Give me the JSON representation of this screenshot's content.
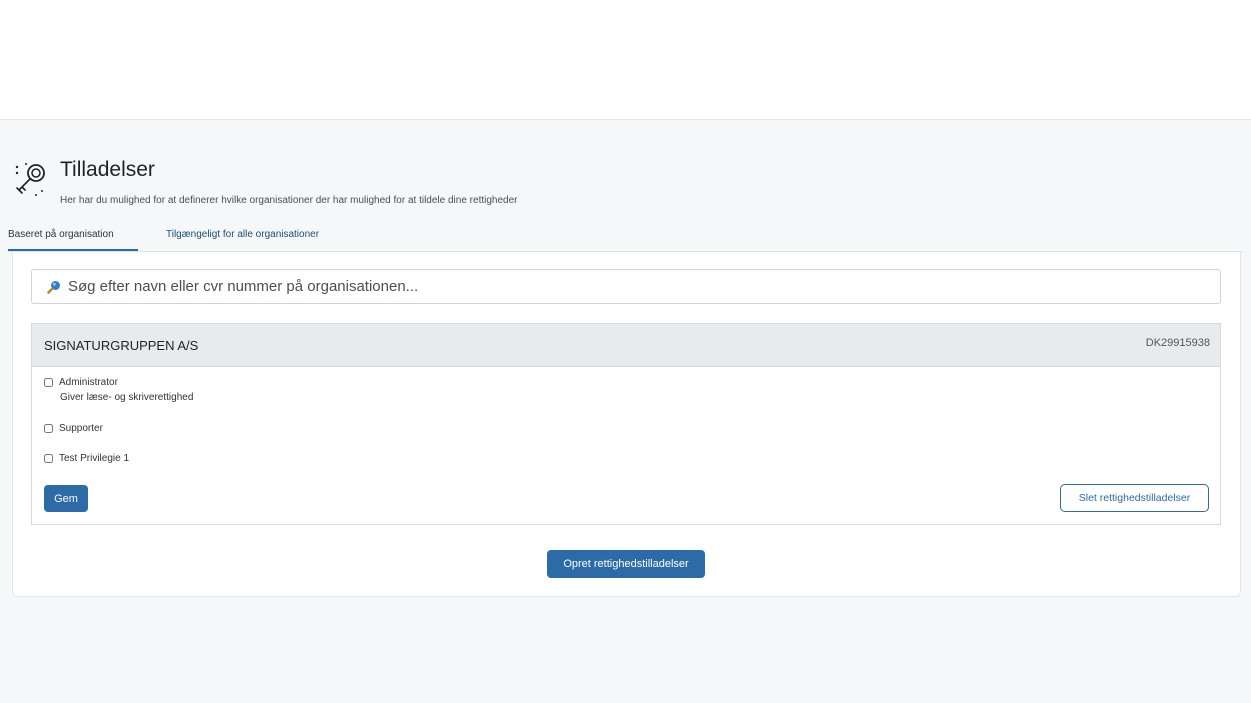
{
  "page": {
    "title": "Tilladelser",
    "subtitle": "Her har du mulighed for at definerer hvilke organisationer der har mulighed for at tildele dine rettigheder"
  },
  "tabs": [
    {
      "label": "Baseret på organisation",
      "active": true
    },
    {
      "label": "Tilgængeligt for alle organisationer",
      "active": false
    }
  ],
  "search": {
    "placeholder": "Søg efter navn eller cvr nummer på organisationen...",
    "value": ""
  },
  "organization": {
    "name": "SIGNATURGRUPPEN A/S",
    "cvr": "DK29915938",
    "permissions": [
      {
        "label": "Administrator",
        "description": "Giver læse- og skriverettighed",
        "checked": false
      },
      {
        "label": "Supporter",
        "description": "",
        "checked": false
      },
      {
        "label": "Test Privilegie 1",
        "description": "",
        "checked": false
      }
    ],
    "save_label": "Gem",
    "delete_label": "Slet rettighedstilladelser"
  },
  "create_label": "Opret rettighedstilladelser",
  "colors": {
    "primary": "#2c6aa8",
    "page_background": "#f5f7f9",
    "panel_header": "#e8ebee"
  },
  "icons": {
    "header": "key-icon",
    "search": "magnifier-icon"
  }
}
